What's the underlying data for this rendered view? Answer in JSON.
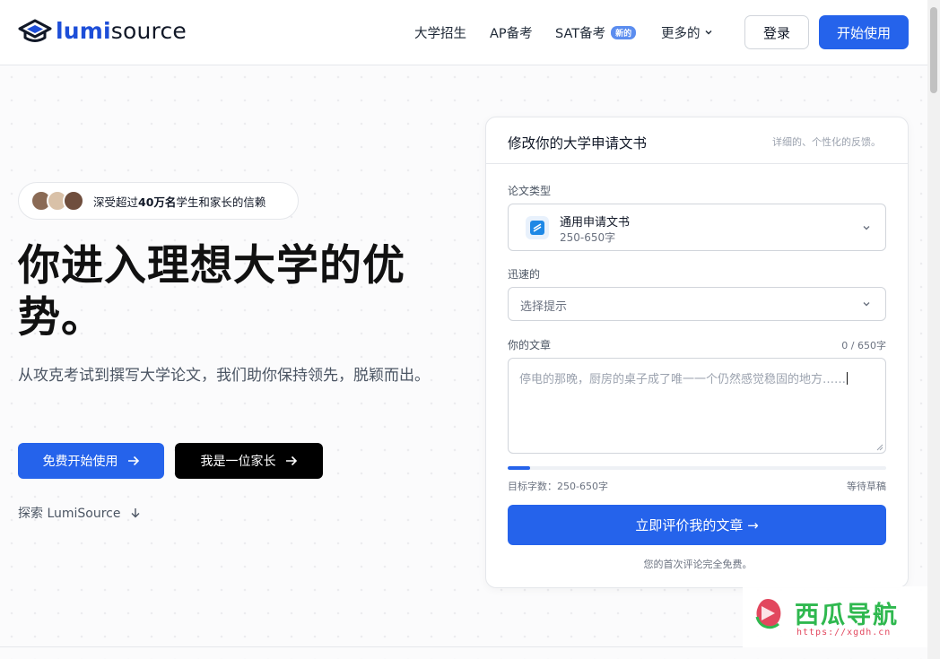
{
  "brand": {
    "name_part1": "lumi",
    "name_part2": "source",
    "logo_icon": "graduation-cap-icon",
    "accent": "#2563eb"
  },
  "nav": {
    "items": [
      {
        "label": "大学招生"
      },
      {
        "label": "AP备考"
      },
      {
        "label": "SAT备考",
        "badge": "新的"
      },
      {
        "label": "更多的",
        "icon": "chevron-down-icon"
      }
    ],
    "login_label": "登录",
    "start_label": "开始使用"
  },
  "hero": {
    "trust_prefix": "深受超过",
    "trust_highlight": "40万名",
    "trust_suffix": "学生和家长的信赖",
    "title": "你进入理想大学的优势。",
    "subtitle": "从攻克考试到撰写大学论文，我们助你保持领先，脱颖而出。",
    "cta_primary": "免费开始使用",
    "cta_secondary": "我是一位家长",
    "explore_label": "探索 LumiSource",
    "arrow_icon": "arrow-right-icon",
    "explore_icon": "arrow-down-icon"
  },
  "essay_card": {
    "title": "修改你的大学申请文书",
    "note": "详细的、个性化的反馈。",
    "type_label": "论文类型",
    "type_value": "通用申请文书",
    "type_range": "250-650字",
    "prompt_label": "迅速的",
    "prompt_placeholder": "选择提示",
    "essay_label": "你的文章",
    "word_count": "0 / 650字",
    "essay_placeholder": "停电的那晚，厨房的桌子成了唯一一个仍然感觉稳固的地方……",
    "progress": 0.06,
    "target_label": "目标字数：250-650字",
    "status_label": "等待草稿",
    "submit_label": "立即评价我的文章 →",
    "free_note": "您的首次评论完全免费。"
  },
  "watermark": {
    "title": "西瓜导航",
    "url": "https://xgdh.cn"
  }
}
